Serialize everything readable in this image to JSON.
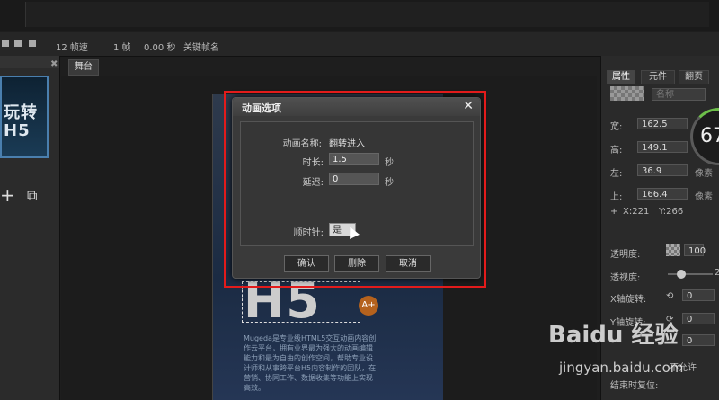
{
  "timeline": {
    "fps": "12 帧速",
    "frame": "1 帧",
    "time": "0.00 秒",
    "keyframe_name": "关键帧名"
  },
  "stage": {
    "tab_label": "舞台",
    "thumb_text": "玩转 H5",
    "canvas_h5": "H5",
    "canvas_badge": "A+",
    "canvas_paragraph": "Mugeda是专业级HTML5交互动画内容创作云平台，拥有业界最为强大的动画编辑能力和最为自由的创作空间，帮助专业设计师和从事跨平台H5内容制作的团队，在营销、协同工作、数据收集等功能上实现高效。"
  },
  "right_panel": {
    "tabs": [
      "属性",
      "元件",
      "翻页"
    ],
    "name_placeholder": "名称",
    "width_label": "宽:",
    "width_value": "162.5",
    "height_label": "高:",
    "height_value": "149.1",
    "left_label": "左:",
    "left_value": "36.9",
    "top_label": "上:",
    "top_value": "166.4",
    "unit": "像素",
    "x_readout": "X:221",
    "y_readout": "Y:266",
    "opacity_label": "透明度:",
    "opacity_value": "100",
    "perspective_label": "透视度:",
    "perspective_value": "2",
    "xrot_label": "X轴旋转:",
    "xrot_value": "0",
    "yrot_label": "Y轴旋转:",
    "yrot_value": "0",
    "rot_value": "0",
    "not_allowed": "不允许",
    "reset_label": "结束时复位:",
    "gauge_value": "67"
  },
  "dialog": {
    "title": "动画选项",
    "name_label": "动画名称:",
    "name_value": "翻转进入",
    "duration_label": "时长:",
    "duration_value": "1.5",
    "delay_label": "延迟:",
    "delay_value": "0",
    "seconds": "秒",
    "clockwise_label": "顺时针:",
    "clockwise_value": "是",
    "confirm": "确认",
    "delete": "删除",
    "cancel": "取消"
  },
  "watermark": {
    "logo": "Baidu 经验",
    "url": "jingyan.baidu.com"
  },
  "colors": {
    "highlight_frame": "#e21b1b",
    "gauge_accent": "#6dbf4a"
  }
}
